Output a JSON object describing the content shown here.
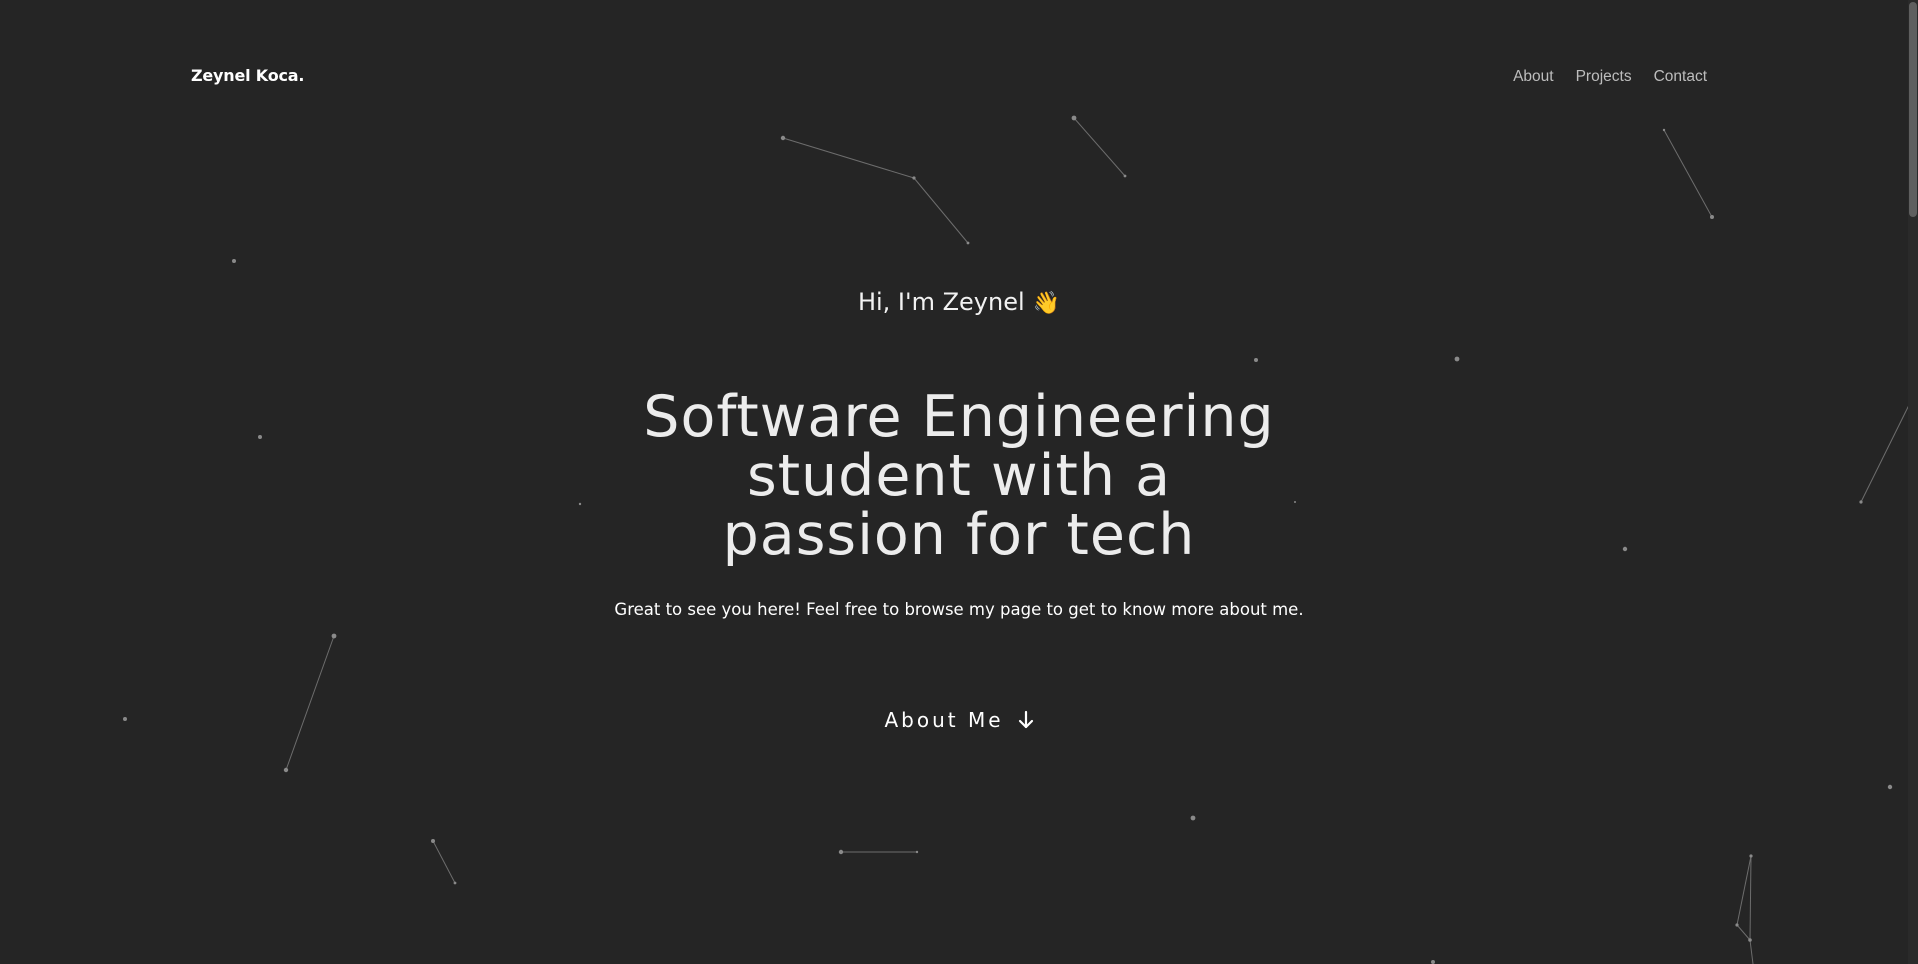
{
  "header": {
    "brand": "Zeynel Koca.",
    "nav": [
      "About",
      "Projects",
      "Contact"
    ]
  },
  "hero": {
    "greeting": "Hi, I'm Zeynel",
    "wave": "👋",
    "headline_lines": [
      "Software Engineering",
      "student with a",
      "passion for tech"
    ],
    "subtitle": "Great to see you here! Feel free to browse my page to get to know more about me.",
    "cta_label": "About Me",
    "cta_icon": "arrow-down-icon"
  },
  "colors": {
    "background": "#252525",
    "text": "#ececec",
    "nav_text": "#bdbdbd",
    "particle": "#8a8a8a",
    "wave_accent": "#f5c542"
  }
}
